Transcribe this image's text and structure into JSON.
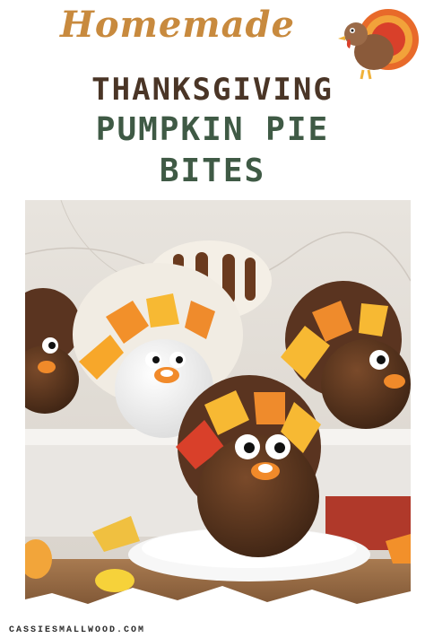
{
  "header": {
    "script_title": "Homemade",
    "line1": "THANKSGIVING",
    "line2": "PUMPKIN PIE",
    "line3": "BITES"
  },
  "footer": {
    "site": "CASSIESMALLWOOD.COM"
  },
  "icons": {
    "logo": "turkey-icon"
  },
  "colors": {
    "script": "#c88a3e",
    "line1": "#4a3526",
    "line2": "#3f5a45"
  }
}
